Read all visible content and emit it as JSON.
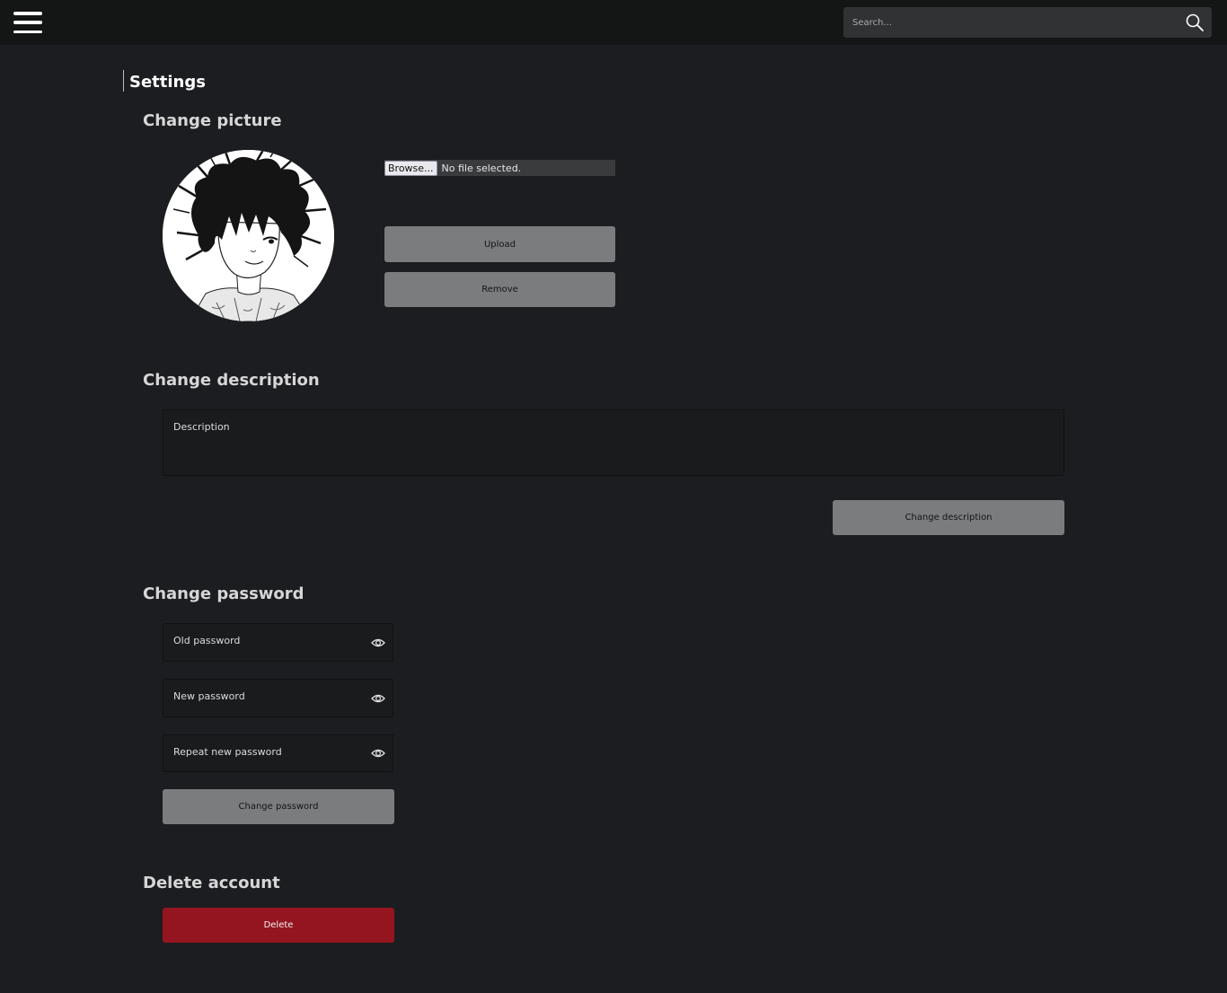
{
  "header": {
    "menu_icon": "hamburger-menu-icon",
    "search_placeholder": "Search...",
    "search_icon": "search-icon"
  },
  "page": {
    "title": "Settings"
  },
  "picture": {
    "title": "Change picture",
    "avatar_alt": "profile-picture",
    "browse_label": "Browse...",
    "file_status": "No file selected.",
    "upload_label": "Upload",
    "remove_label": "Remove"
  },
  "description": {
    "title": "Change description",
    "placeholder": "Description",
    "button_label": "Change description"
  },
  "password": {
    "title": "Change password",
    "old_placeholder": "Old password",
    "new_placeholder": "New password",
    "repeat_placeholder": "Repeat new password",
    "eye_icon": "eye-icon",
    "button_label": "Change password"
  },
  "delete_account": {
    "title": "Delete account",
    "button_label": "Delete"
  },
  "colors": {
    "background": "#1c1d20",
    "topbar": "#141515",
    "button_gray": "#7b7c7e",
    "danger": "#94151f"
  }
}
